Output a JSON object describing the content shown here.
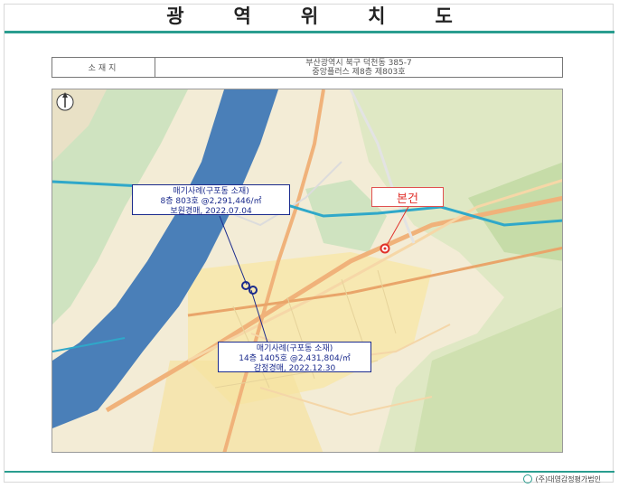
{
  "header": {
    "title": "광역위치도"
  },
  "info": {
    "label": "소재지",
    "address_line1": "부산광역시 북구 덕천동 385-7",
    "address_line2": "중앙플러스 제8층 제803호"
  },
  "map": {
    "callouts": [
      {
        "line1": "매기사례(구포동 소재)",
        "line2": "8층 803호 @2,291,446/㎡",
        "line3": "보원경매, 2022.07.04"
      },
      {
        "line1": "매기사례(구포동 소재)",
        "line2": "14층 1405호 @2,431,804/㎡",
        "line3": "감정경매, 2022.12.30"
      }
    ],
    "subject_label": "본건",
    "colors": {
      "subject": "#e0302a",
      "comparable": "#1a2a8c",
      "river": "#4a7fb8",
      "rail": "#2fa8c9"
    },
    "icons": [
      "north-arrow-icon",
      "subject-marker-icon",
      "comparable-marker-icon"
    ]
  },
  "footer": {
    "company": "(주)대영감정평가법인"
  }
}
